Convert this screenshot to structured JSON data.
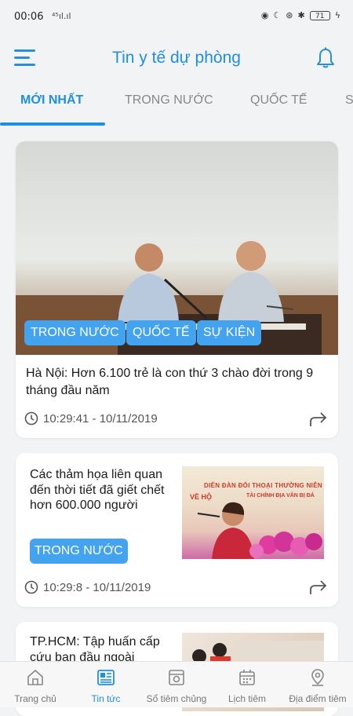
{
  "status_bar": {
    "time": "00:06",
    "signal": "⁴⁵ıl.ıl",
    "battery": "71"
  },
  "header": {
    "title": "Tin y tế dự phòng"
  },
  "tabs": [
    {
      "label": "MỚI NHẤT"
    },
    {
      "label": "TRONG NƯỚC"
    },
    {
      "label": "QUỐC TẾ"
    },
    {
      "label": "S"
    }
  ],
  "articles": [
    {
      "tags": [
        "TRONG NƯỚC",
        "QUỐC TẾ",
        "SỰ KIỆN"
      ],
      "title": "Hà Nội: Hơn 6.100 trẻ là con thứ 3 chào đời trong 9 tháng đầu năm",
      "time": "10:29:41 - 10/11/2019"
    },
    {
      "title": "Các thảm họa liên quan đến thời tiết đã giết chết hơn 600.000 người",
      "tags": [
        "TRONG NƯỚC"
      ],
      "time": "10:29:8 - 10/11/2019",
      "image_text": [
        "DIỄN ĐÀN ĐỐI THOẠI THƯỜNG NIÊN",
        "VỀ HỘ",
        "TÀI CHÍNH ĐỊA VĂN BỊ ĐÁ"
      ]
    },
    {
      "title": "TP.HCM: Tập huấn cấp cứu ban đầu ngoài"
    }
  ],
  "bottom_nav": [
    {
      "label": "Trang chủ"
    },
    {
      "label": "Tin tức"
    },
    {
      "label": "Sổ tiêm chủng"
    },
    {
      "label": "Lịch tiêm"
    },
    {
      "label": "Địa điểm tiêm"
    }
  ],
  "colors": {
    "accent": "#1f8fe0",
    "tag": "#43a3ef"
  }
}
